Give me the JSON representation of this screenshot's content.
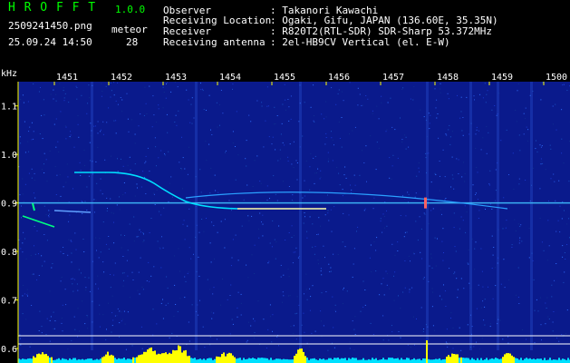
{
  "app": {
    "name": "H R O F F T",
    "version": "1.0.0"
  },
  "file": {
    "name": "2509241450.png",
    "datetime": "25.09.24 14:50"
  },
  "meteor": {
    "label": "meteor",
    "count": "28"
  },
  "info": [
    {
      "key": "Observer",
      "value": ": Takanori Kawachi"
    },
    {
      "key": "Receiving Location",
      "value": ": Ogaki, Gifu, JAPAN (136.60E, 35.35N)"
    },
    {
      "key": "Receiver",
      "value": ": R820T2(RTL-SDR) SDR-Sharp 53.372MHz"
    },
    {
      "key": "Receiving antenna",
      "value": ": 2el-HB9CV Vertical (el. E-W)"
    }
  ],
  "chart_data": {
    "type": "heatmap",
    "ylabel": "kHz",
    "x_tick_labels": [
      "1451",
      "1452",
      "1453",
      "1454",
      "1455",
      "1456",
      "1457",
      "1458",
      "1459",
      "1500"
    ],
    "y_tick_labels": [
      "1.1",
      "1.0",
      "0.9",
      "0.8",
      "0.7",
      "0.6"
    ],
    "ylim": [
      0.57,
      1.15
    ],
    "carrier_khz": 0.9,
    "colors": {
      "background": "#0a1a8c",
      "trace": "#00e0ff",
      "spectrum": "#ffff00",
      "axis": "#ffff00"
    }
  }
}
